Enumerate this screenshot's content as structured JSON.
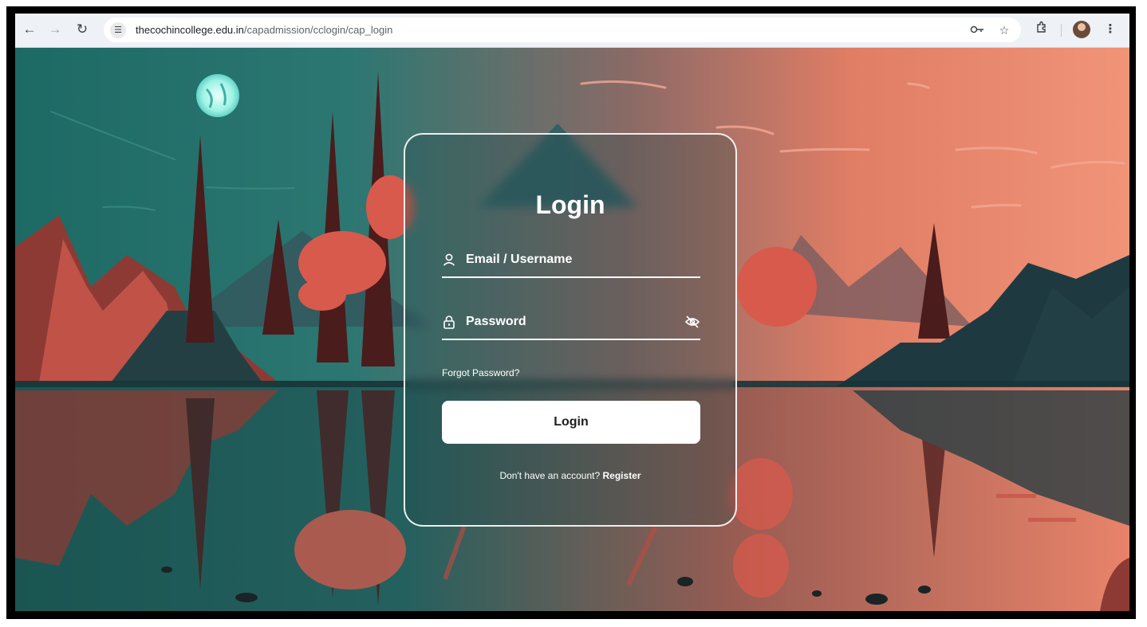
{
  "browser": {
    "url_host": "thecochincollege.edu.in",
    "url_path": "/capadmission/cclogin/cap_login",
    "icons": [
      "back-icon",
      "forward-icon",
      "reload-icon",
      "site-info-icon",
      "password-key-icon",
      "star-icon",
      "extensions-icon",
      "profile-avatar",
      "menu-icon"
    ]
  },
  "login": {
    "title": "Login",
    "email_label": "Email / Username",
    "password_label": "Password",
    "forgot_label": "Forgot Password?",
    "button_label": "Login",
    "register_prompt": "Don't have an account?",
    "register_link": "Register"
  },
  "colors": {
    "sky_teal": "#2f7c77",
    "sky_coral": "#ef8a70",
    "tree_red": "#d85a4c",
    "card_border": "#ffffff"
  }
}
